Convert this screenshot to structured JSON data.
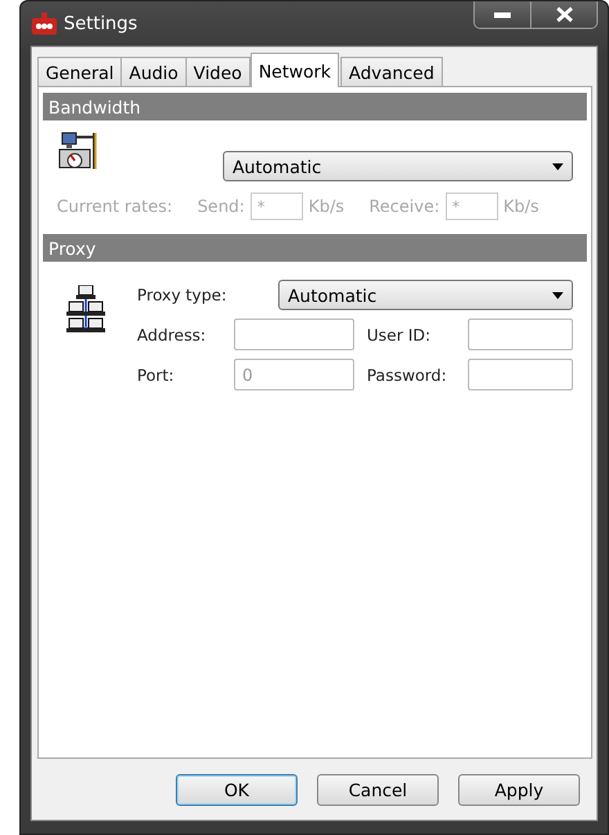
{
  "window": {
    "title": "Settings"
  },
  "tabs": [
    {
      "label": "General",
      "selected": false
    },
    {
      "label": "Audio",
      "selected": false
    },
    {
      "label": "Video",
      "selected": false
    },
    {
      "label": "Network",
      "selected": true
    },
    {
      "label": "Advanced",
      "selected": false
    }
  ],
  "bandwidth": {
    "title": "Bandwidth",
    "mode": "Automatic",
    "rates_label": "Current rates:",
    "send_label": "Send:",
    "send_value": "*",
    "send_unit": "Kb/s",
    "receive_label": "Receive:",
    "receive_value": "*",
    "receive_unit": "Kb/s",
    "disabled": true
  },
  "proxy": {
    "title": "Proxy",
    "type_label": "Proxy type:",
    "type": "Automatic",
    "address_label": "Address:",
    "user_label": "User ID:",
    "port_label": "Port:",
    "port": "0",
    "password_label": "Password:"
  },
  "buttons": [
    {
      "label": "OK",
      "default": true
    },
    {
      "label": "Cancel",
      "default": false
    },
    {
      "label": "Apply",
      "default": false
    }
  ]
}
